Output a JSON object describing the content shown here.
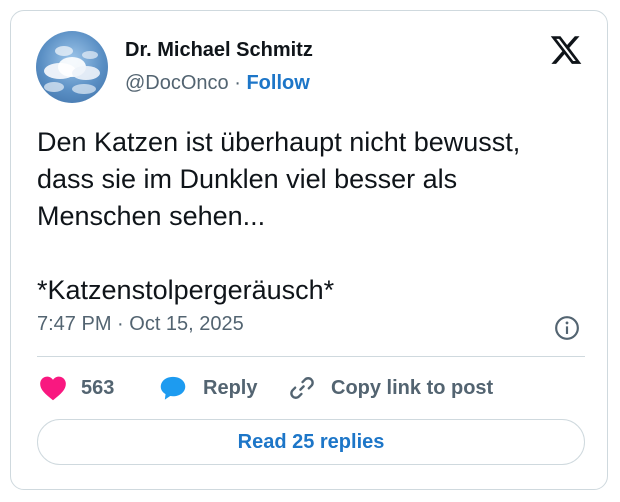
{
  "author": {
    "name": "Dr. Michael Schmitz",
    "handle": "@DocOnco",
    "separator": " · ",
    "follow_label": "Follow"
  },
  "tweet": {
    "text": "Den Katzen ist überhaupt nicht bewusst,\ndass sie im Dunklen viel besser als\nMenschen sehen...\n\n*Katzenstolpergeräusch*",
    "timestamp": "7:47 PM · Oct 15, 2025"
  },
  "actions": {
    "likes_count": "563",
    "reply_label": "Reply",
    "copy_label": "Copy link to post"
  },
  "read_replies_label": "Read 25 replies",
  "icons": {
    "brand": "x-logo-icon",
    "info": "info-icon",
    "like": "heart-icon",
    "reply": "speech-bubble-icon",
    "copy": "link-icon"
  },
  "colors": {
    "like": "#f91880",
    "reply": "#1d9bf0",
    "link": "#1d76c8",
    "muted": "#536471",
    "border": "#cfd9de"
  }
}
